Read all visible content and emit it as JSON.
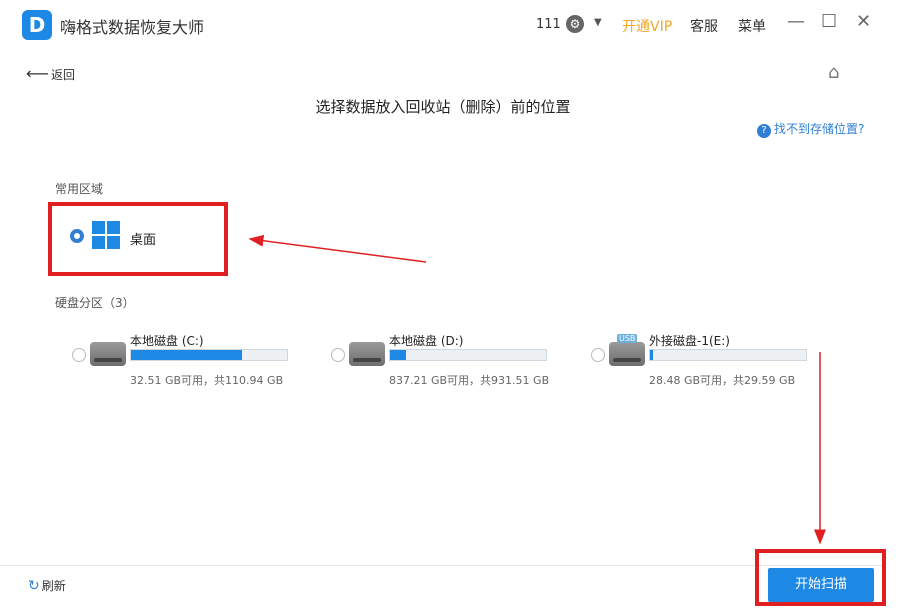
{
  "app": {
    "logo_letter": "D",
    "title": "嗨格式数据恢复大师",
    "user": "111",
    "vip": "开通VIP",
    "support": "客服",
    "menu": "菜单",
    "minimize": "—",
    "maximize": "☐",
    "close": "✕"
  },
  "nav": {
    "back": "返回",
    "back_arrow": "⟵"
  },
  "heading": "选择数据放入回收站（删除）前的位置",
  "help_link": "找不到存储位置?",
  "common": {
    "label": "常用区域",
    "desktop": "桌面"
  },
  "drives_section": {
    "label": "硬盘分区（3）",
    "drives": [
      {
        "name": "本地磁盘 (C:)",
        "info": "32.51 GB可用，共110.94 GB",
        "used_fraction": 0.71,
        "usb": false
      },
      {
        "name": "本地磁盘 (D:)",
        "info": "837.21 GB可用，共931.51 GB",
        "used_fraction": 0.1,
        "usb": false
      },
      {
        "name": "外接磁盘-1(E:)",
        "info": "28.48 GB可用，共29.59 GB",
        "used_fraction": 0.02,
        "usb": true,
        "usb_tag": "USB"
      }
    ]
  },
  "footer": {
    "refresh": "刷新",
    "scan": "开始扫描"
  },
  "colors": {
    "accent": "#1e88e5",
    "annotation": "#e02020",
    "vip": "#f5a623"
  }
}
